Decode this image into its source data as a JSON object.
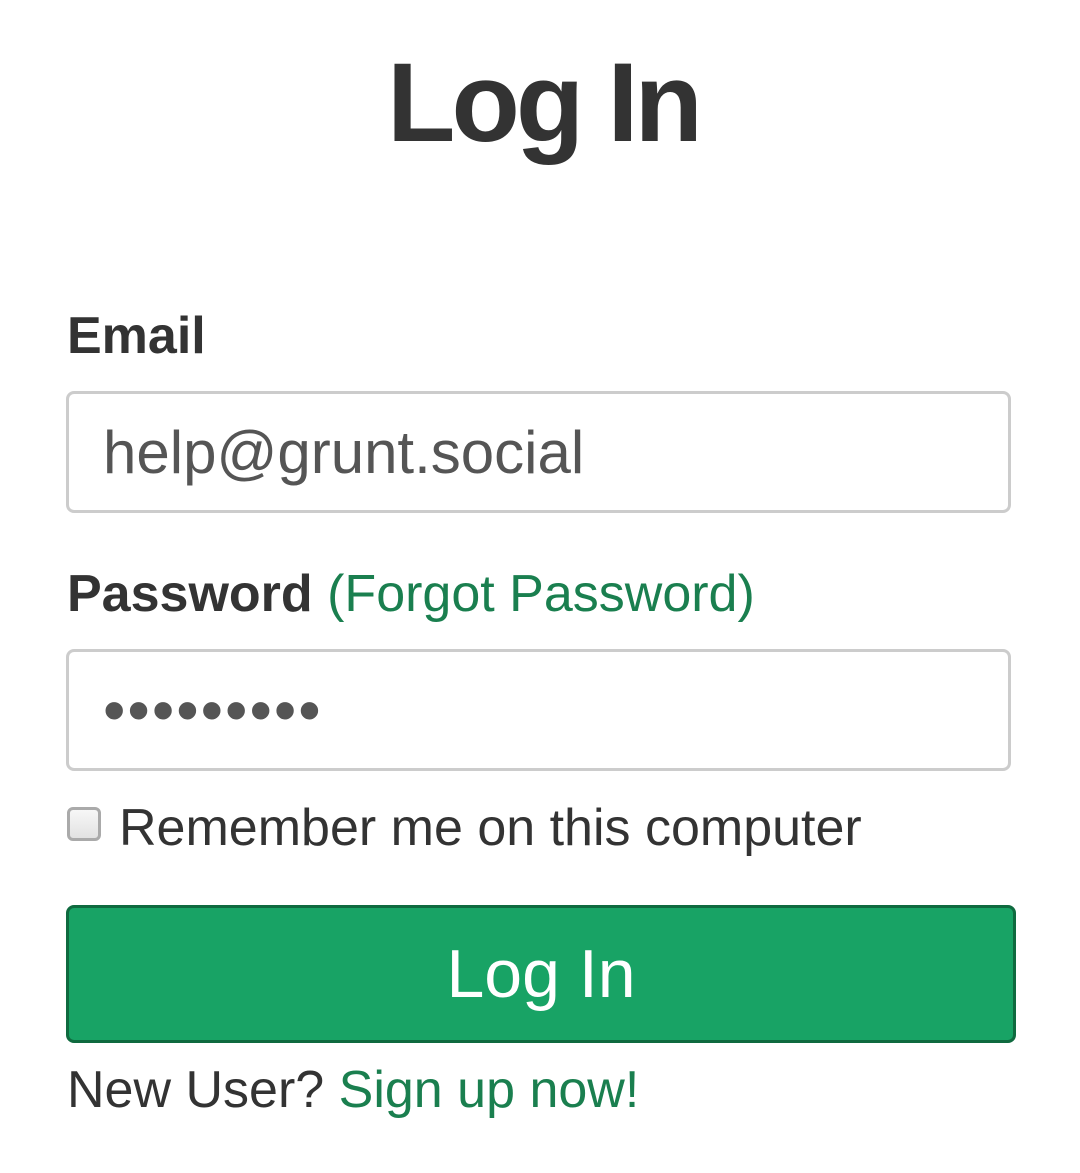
{
  "page": {
    "title": "Log In"
  },
  "form": {
    "email_label": "Email",
    "email_value": "help@grunt.social",
    "password_label": "Password",
    "forgot_password_link": "(Forgot Password)",
    "password_value": "•••••••••",
    "remember_label": "Remember me on this computer",
    "remember_checked": false,
    "submit_label": "Log In"
  },
  "footer": {
    "new_user_text": "New User?",
    "signup_link": "Sign up now!"
  },
  "colors": {
    "primary_button": "#18a365",
    "link": "#1a7f4f",
    "text": "#333333"
  }
}
